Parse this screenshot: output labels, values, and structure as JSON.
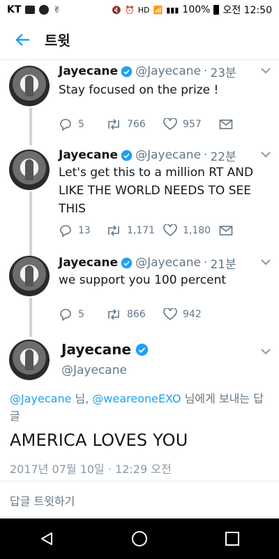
{
  "status_bar": {
    "carrier": "KT",
    "battery": "100%",
    "time": "오전 12:50"
  },
  "header": {
    "title": "트윗"
  },
  "thread": [
    {
      "name": "Jayecane",
      "handle": "@Jayecane",
      "time": "23분",
      "text": "Stay focused on the prize !",
      "replies": "5",
      "retweets": "766",
      "likes": "957"
    },
    {
      "name": "Jayecane",
      "handle": "@Jayecane",
      "time": "22분",
      "text": "Let's get this to a million RT AND LIKE THE WORLD NEEDS TO SEE THIS",
      "replies": "13",
      "retweets": "1,171",
      "likes": "1,180"
    },
    {
      "name": "Jayecane",
      "handle": "@Jayecane",
      "time": "21분",
      "text": "we support you 100 percent",
      "replies": "5",
      "retweets": "866",
      "likes": "942"
    }
  ],
  "main_tweet": {
    "name": "Jayecane",
    "handle": "@Jayecane",
    "reply_mention_1": "@Jayecane",
    "reply_suffix_1": " 님, ",
    "reply_mention_2": "@weareoneEXO",
    "reply_suffix_2": " 님에게 보내는 답글",
    "text": "AMERICA LOVES YOU",
    "timestamp": "2017년 07월 10일 · 12:29 오전"
  },
  "reply_box": {
    "placeholder": "답글 트윗하기"
  },
  "colors": {
    "accent": "#1da1f2",
    "secondary_text": "#657786",
    "thread_line": "#ccd6dd"
  }
}
